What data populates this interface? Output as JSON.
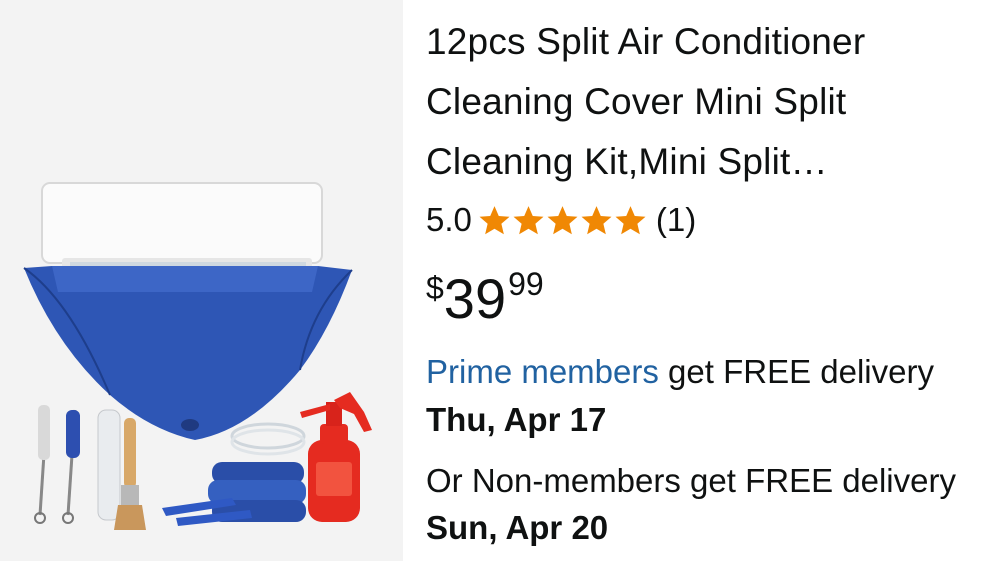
{
  "product": {
    "title_lines": [
      "12pcs Split Air Conditioner",
      "Cleaning Cover Mini Split",
      "Cleaning Kit,Mini Split…"
    ],
    "image_icon": "ac-cleaning-kit-photo",
    "rating": {
      "value": "5.0",
      "stars_filled": 5,
      "stars_total": 5,
      "count": "(1)",
      "star_color": "#f08804"
    },
    "price": {
      "symbol": "$",
      "whole": "39",
      "fraction": "99"
    },
    "delivery_prime": {
      "link_text": "Prime members",
      "text": " get FREE delivery",
      "date": "Thu, Apr 17",
      "link_color": "#2162a1"
    },
    "delivery_non_member": {
      "text": "Or Non-members get FREE delivery ",
      "date": "Sun, Apr 20"
    }
  }
}
